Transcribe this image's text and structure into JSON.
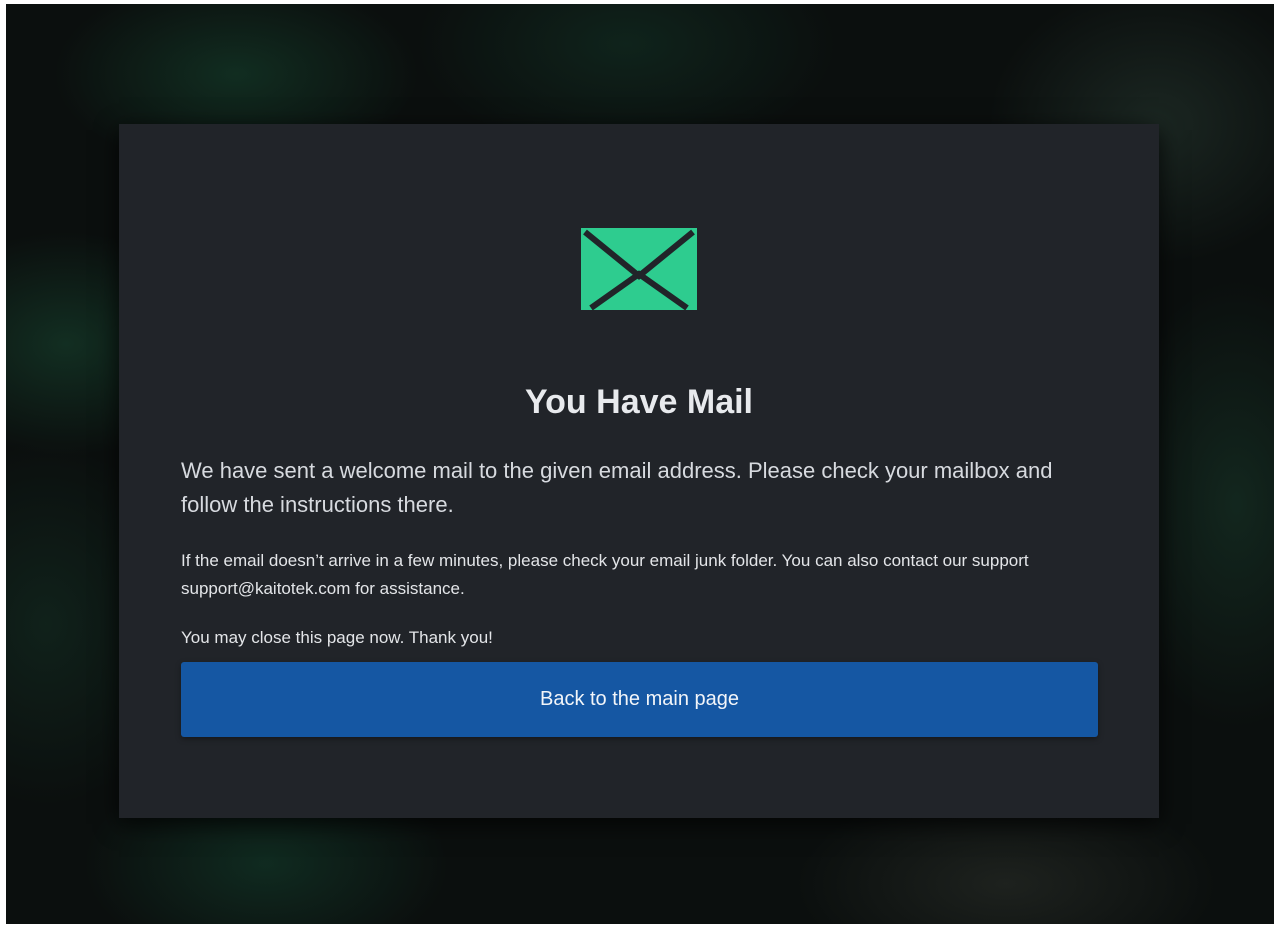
{
  "card": {
    "icon": "envelope-icon",
    "title": "You Have Mail",
    "lead": "We have sent a welcome mail to the given email address. Please check your mailbox and follow the instructions there.",
    "note": "If the email doesn’t arrive in a few minutes, please check your email junk folder. You can also contact our support support@kaitotek.com for assistance.",
    "thanks": "You may close this page now. Thank you!",
    "button_label": "Back to the main page"
  },
  "colors": {
    "accent": "#2ecc8f",
    "button": "#1557a3",
    "card_background": "#212429",
    "page_background": "#0b0f0e"
  }
}
